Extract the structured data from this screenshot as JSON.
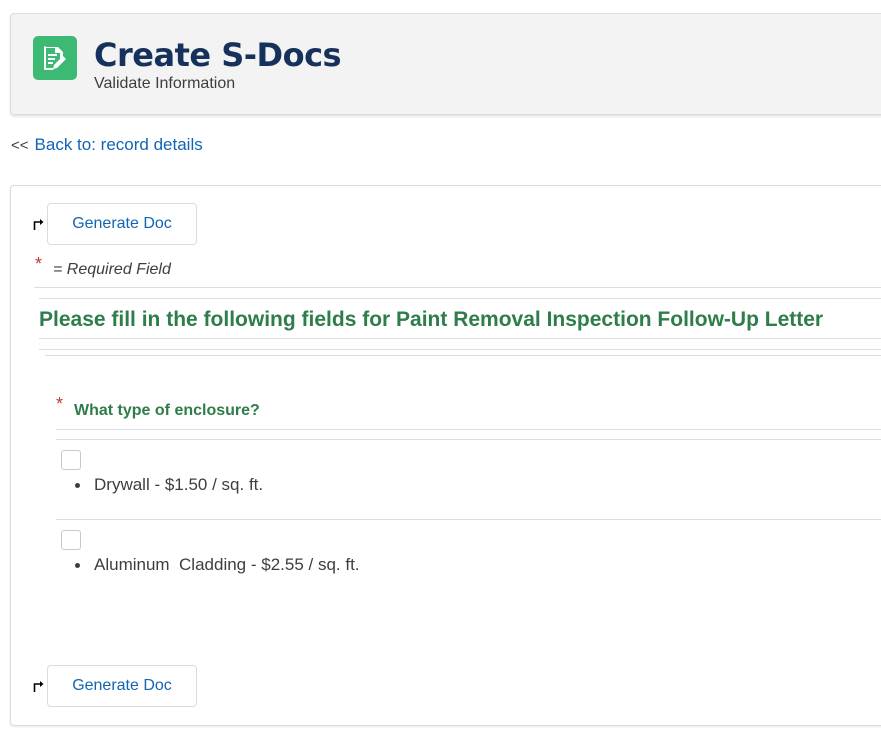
{
  "header": {
    "title": "Create S-Docs",
    "subtitle": "Validate Information",
    "icon": "document-edit-icon",
    "icon_color": "#3cba73"
  },
  "back": {
    "arrows": "<<",
    "label": "Back to: record details"
  },
  "form": {
    "generate_label_top": "Generate Doc",
    "generate_label_bottom": "Generate Doc",
    "required_marker": "*",
    "required_text": "= Required Field",
    "section_title": "Please fill in the following fields for Paint Removal Inspection Follow-Up Letter",
    "question": {
      "required_marker": "*",
      "label": "What type of enclosure?",
      "options": [
        {
          "label": "Drywall - $1.50 / sq. ft.",
          "checked": false
        },
        {
          "label": "Aluminum  Cladding - $2.55 / sq. ft.",
          "checked": false
        }
      ]
    }
  },
  "colors": {
    "link": "#1264b5",
    "section_green": "#2e7d4a",
    "required_red": "#c23934",
    "title_navy": "#16325c"
  }
}
